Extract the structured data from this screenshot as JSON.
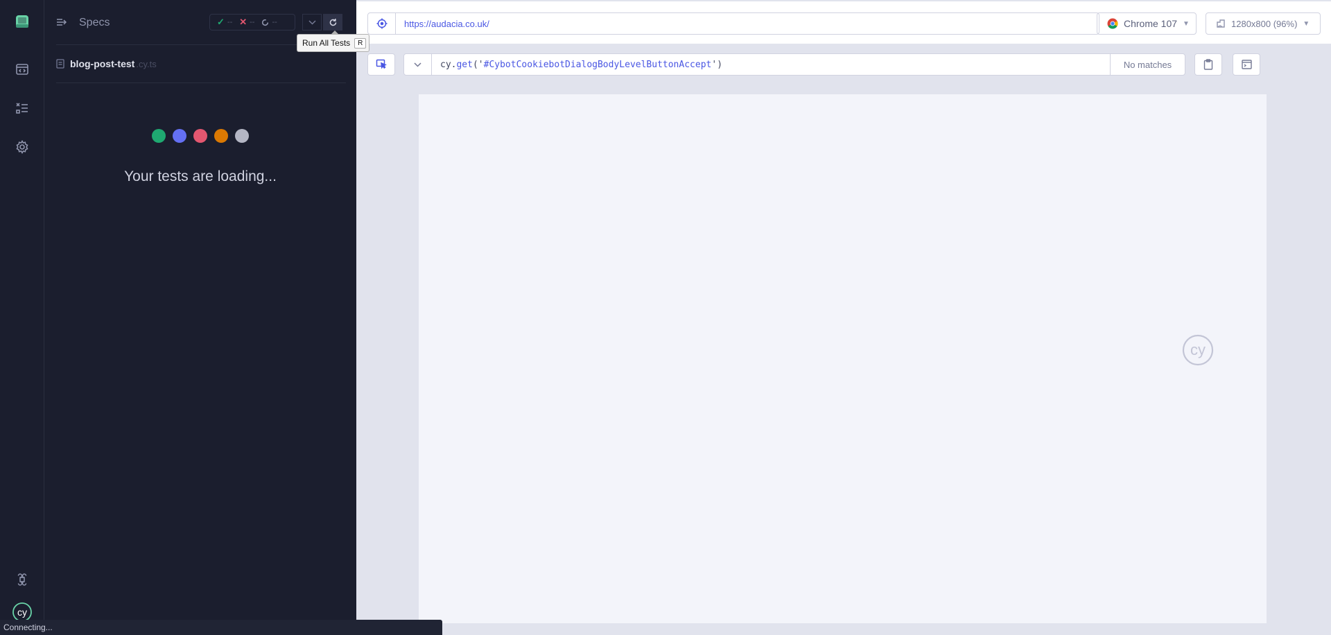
{
  "rail": {
    "items": [
      {
        "name": "app-logo-icon"
      },
      {
        "name": "specs-nav-icon"
      },
      {
        "name": "runs-nav-icon"
      },
      {
        "name": "settings-nav-icon"
      }
    ],
    "bottom": [
      {
        "name": "keyboard-shortcuts-icon"
      },
      {
        "name": "cypress-logo-icon"
      }
    ]
  },
  "reporter": {
    "specs_label": "Specs",
    "stats": {
      "passed_glyph": "✓",
      "passed": "--",
      "failed_glyph": "✕",
      "failed": "--",
      "pending": "--"
    },
    "tooltip": {
      "label": "Run All Tests",
      "shortcut": "R"
    },
    "spec": {
      "name": "blog-post-test",
      "ext": ".cy.ts"
    },
    "loading_text": "Your tests are loading...",
    "dot_colors": [
      "#1fa971",
      "#6470f3",
      "#e45770",
      "#db7903",
      "#b4b6c4"
    ]
  },
  "aut": {
    "url": "https://audacia.co.uk/",
    "browser": "Chrome 107",
    "viewport": "1280x800 (96%)",
    "selector": {
      "prefix": "cy",
      "dot": ".",
      "fn": "get",
      "open": "(",
      "quote_open": "'",
      "value": "#CybotCookiebotDialogBodyLevelButtonAccept",
      "quote_close": "'",
      "close": ")",
      "matches": "No matches"
    }
  },
  "status": {
    "text": "Connecting..."
  },
  "colors": {
    "accent": "#4956e3",
    "dark_bg": "#1b1e2e",
    "frame_bg": "#f3f4fa"
  }
}
